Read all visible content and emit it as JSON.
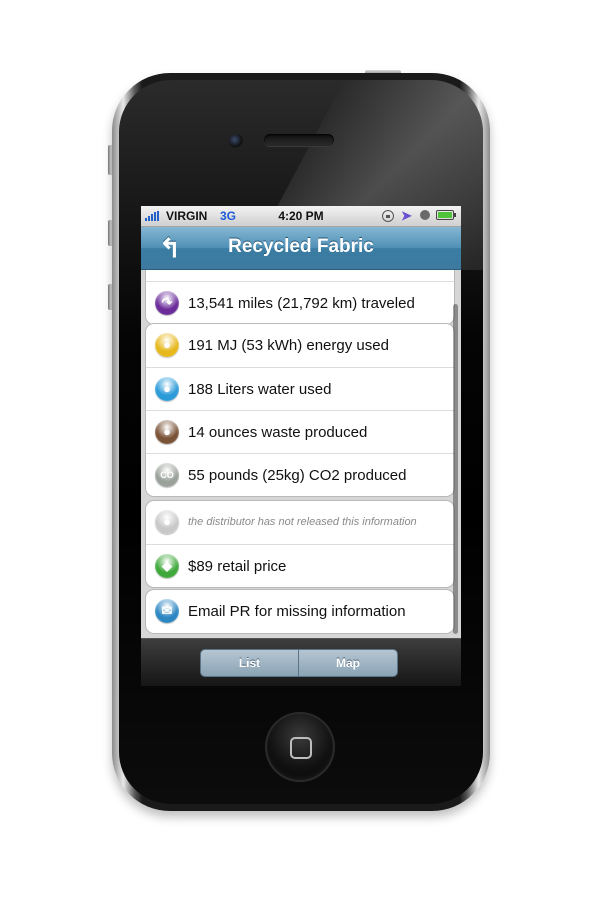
{
  "status_bar": {
    "carrier": "VIRGIN",
    "network": "3G",
    "time": "4:20 PM",
    "icons": [
      "signal-bars-icon",
      "lock-rotation-icon",
      "location-arrow-icon",
      "alarm-clock-icon",
      "battery-icon"
    ],
    "signal_color": "#2261c9",
    "battery_color": "#4fc43a"
  },
  "nav": {
    "title": "Recycled Fabric",
    "back_icon": "back-arrow-icon",
    "bar_color": "#4f8fb5"
  },
  "groups": [
    {
      "rows": [
        {
          "icon": "travel-icon",
          "glyph": "↷",
          "color": "#6b2c9a",
          "text": "13,541 miles (21,792 km) traveled",
          "muted": false
        }
      ]
    },
    {
      "rows": [
        {
          "icon": "lightbulb-icon",
          "glyph": "●",
          "color": "#e6b81c",
          "text": "191 MJ (53 kWh) energy used",
          "muted": false
        },
        {
          "icon": "water-drop-icon",
          "glyph": "●",
          "color": "#2a9ad8",
          "text": "188 Liters water used",
          "muted": false
        },
        {
          "icon": "waste-bag-icon",
          "glyph": "●",
          "color": "#7a5236",
          "text": "14 ounces waste produced",
          "muted": false
        },
        {
          "icon": "co2-icon",
          "glyph": "CO",
          "color": "#9aa19a",
          "text": "55 pounds (25kg) CO2 produced",
          "muted": false
        }
      ]
    },
    {
      "rows": [
        {
          "icon": "thumbs-icon",
          "glyph": "●",
          "color": "#c8c8c8",
          "text": "the distributor has not released this information",
          "muted": true
        },
        {
          "icon": "price-tag-icon",
          "glyph": "◆",
          "color": "#3fa83a",
          "text": "$89 retail price",
          "muted": false
        }
      ]
    },
    {
      "rows": [
        {
          "icon": "email-icon",
          "glyph": "✉",
          "color": "#2b86c2",
          "text": "Email PR for missing information",
          "muted": false
        }
      ]
    }
  ],
  "toolbar": {
    "list_label": "List",
    "map_label": "Map"
  }
}
